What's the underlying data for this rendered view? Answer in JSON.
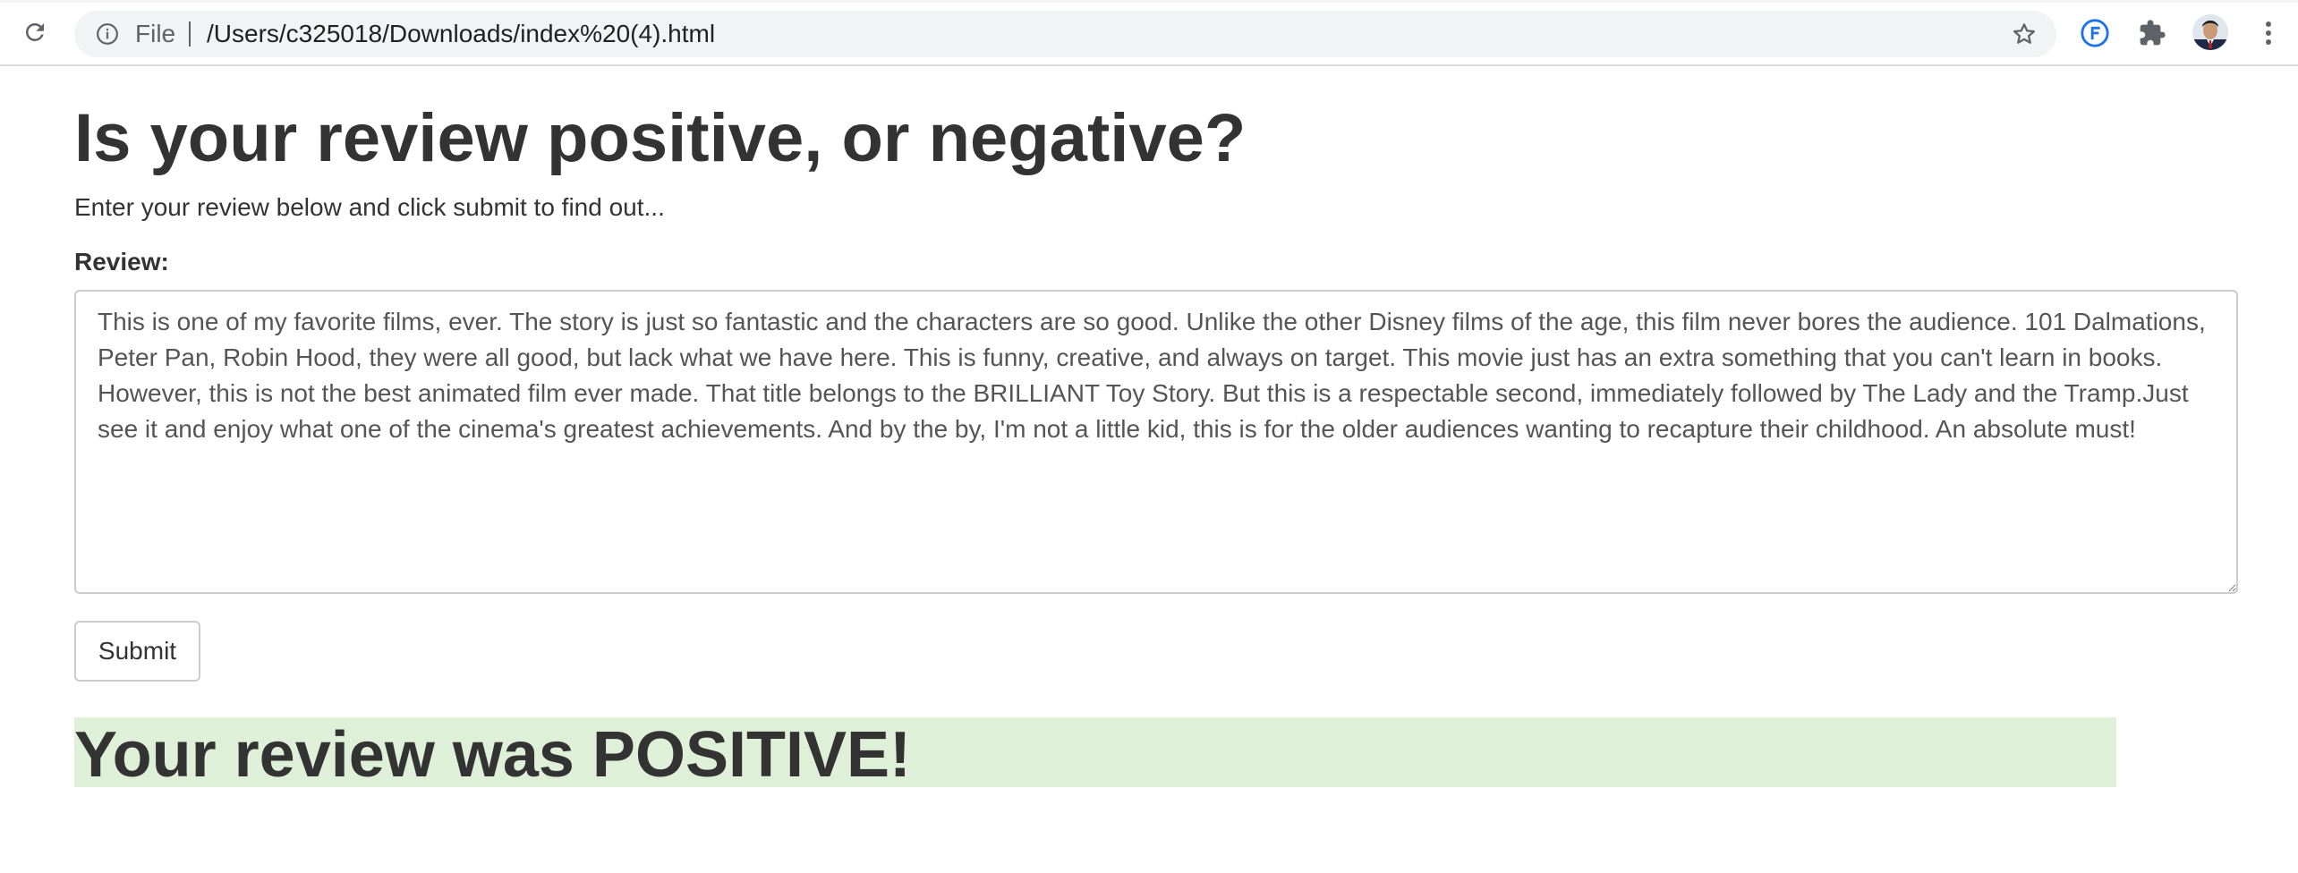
{
  "browser": {
    "scheme_label": "File",
    "url": "/Users/c325018/Downloads/index%20(4).html",
    "icons": {
      "reload": "reload-icon",
      "info": "info-icon",
      "bookmark": "star-icon",
      "extension_1": "flashcard-extension-icon",
      "extensions": "puzzle-icon",
      "profile": "avatar",
      "menu": "kebab-menu-icon"
    },
    "colors": {
      "omnibox_bg": "#f1f3f4",
      "extension_accent": "#1a73e8"
    }
  },
  "page": {
    "title": "Is your review positive, or negative?",
    "subtitle": "Enter your review below and click submit to find out...",
    "form": {
      "review_label": "Review:",
      "review_value": "This is one of my favorite films, ever. The story is just so fantastic and the characters are so good. Unlike the other Disney films of the age, this film never bores the audience. 101 Dalmations, Peter Pan, Robin Hood, they were all good, but lack what we have here. This is funny, creative, and always on target. This movie just has an extra something that you can't learn in books. However, this is not the best animated film ever made. That title belongs to the BRILLIANT Toy Story. But this is a respectable second, immediately followed by The Lady and the Tramp.Just see it and enjoy what one of the cinema's greatest achievements. And by the by, I'm not a little kid, this is for the older audiences wanting to recapture their childhood. An absolute must!",
      "submit_label": "Submit"
    },
    "result": {
      "text": "Your review was POSITIVE!",
      "background_color": "#dff0d8"
    }
  }
}
